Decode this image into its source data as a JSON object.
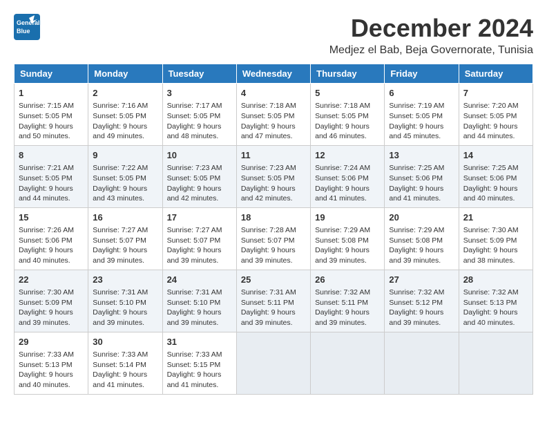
{
  "header": {
    "logo_line1": "General",
    "logo_line2": "Blue",
    "month": "December 2024",
    "location": "Medjez el Bab, Beja Governorate, Tunisia"
  },
  "weekdays": [
    "Sunday",
    "Monday",
    "Tuesday",
    "Wednesday",
    "Thursday",
    "Friday",
    "Saturday"
  ],
  "weeks": [
    [
      {
        "day": 1,
        "sunrise": "7:15 AM",
        "sunset": "5:05 PM",
        "daylight": "9 hours and 50 minutes."
      },
      {
        "day": 2,
        "sunrise": "7:16 AM",
        "sunset": "5:05 PM",
        "daylight": "9 hours and 49 minutes."
      },
      {
        "day": 3,
        "sunrise": "7:17 AM",
        "sunset": "5:05 PM",
        "daylight": "9 hours and 48 minutes."
      },
      {
        "day": 4,
        "sunrise": "7:18 AM",
        "sunset": "5:05 PM",
        "daylight": "9 hours and 47 minutes."
      },
      {
        "day": 5,
        "sunrise": "7:18 AM",
        "sunset": "5:05 PM",
        "daylight": "9 hours and 46 minutes."
      },
      {
        "day": 6,
        "sunrise": "7:19 AM",
        "sunset": "5:05 PM",
        "daylight": "9 hours and 45 minutes."
      },
      {
        "day": 7,
        "sunrise": "7:20 AM",
        "sunset": "5:05 PM",
        "daylight": "9 hours and 44 minutes."
      }
    ],
    [
      {
        "day": 8,
        "sunrise": "7:21 AM",
        "sunset": "5:05 PM",
        "daylight": "9 hours and 44 minutes."
      },
      {
        "day": 9,
        "sunrise": "7:22 AM",
        "sunset": "5:05 PM",
        "daylight": "9 hours and 43 minutes."
      },
      {
        "day": 10,
        "sunrise": "7:23 AM",
        "sunset": "5:05 PM",
        "daylight": "9 hours and 42 minutes."
      },
      {
        "day": 11,
        "sunrise": "7:23 AM",
        "sunset": "5:05 PM",
        "daylight": "9 hours and 42 minutes."
      },
      {
        "day": 12,
        "sunrise": "7:24 AM",
        "sunset": "5:06 PM",
        "daylight": "9 hours and 41 minutes."
      },
      {
        "day": 13,
        "sunrise": "7:25 AM",
        "sunset": "5:06 PM",
        "daylight": "9 hours and 41 minutes."
      },
      {
        "day": 14,
        "sunrise": "7:25 AM",
        "sunset": "5:06 PM",
        "daylight": "9 hours and 40 minutes."
      }
    ],
    [
      {
        "day": 15,
        "sunrise": "7:26 AM",
        "sunset": "5:06 PM",
        "daylight": "9 hours and 40 minutes."
      },
      {
        "day": 16,
        "sunrise": "7:27 AM",
        "sunset": "5:07 PM",
        "daylight": "9 hours and 39 minutes."
      },
      {
        "day": 17,
        "sunrise": "7:27 AM",
        "sunset": "5:07 PM",
        "daylight": "9 hours and 39 minutes."
      },
      {
        "day": 18,
        "sunrise": "7:28 AM",
        "sunset": "5:07 PM",
        "daylight": "9 hours and 39 minutes."
      },
      {
        "day": 19,
        "sunrise": "7:29 AM",
        "sunset": "5:08 PM",
        "daylight": "9 hours and 39 minutes."
      },
      {
        "day": 20,
        "sunrise": "7:29 AM",
        "sunset": "5:08 PM",
        "daylight": "9 hours and 39 minutes."
      },
      {
        "day": 21,
        "sunrise": "7:30 AM",
        "sunset": "5:09 PM",
        "daylight": "9 hours and 38 minutes."
      }
    ],
    [
      {
        "day": 22,
        "sunrise": "7:30 AM",
        "sunset": "5:09 PM",
        "daylight": "9 hours and 39 minutes."
      },
      {
        "day": 23,
        "sunrise": "7:31 AM",
        "sunset": "5:10 PM",
        "daylight": "9 hours and 39 minutes."
      },
      {
        "day": 24,
        "sunrise": "7:31 AM",
        "sunset": "5:10 PM",
        "daylight": "9 hours and 39 minutes."
      },
      {
        "day": 25,
        "sunrise": "7:31 AM",
        "sunset": "5:11 PM",
        "daylight": "9 hours and 39 minutes."
      },
      {
        "day": 26,
        "sunrise": "7:32 AM",
        "sunset": "5:11 PM",
        "daylight": "9 hours and 39 minutes."
      },
      {
        "day": 27,
        "sunrise": "7:32 AM",
        "sunset": "5:12 PM",
        "daylight": "9 hours and 39 minutes."
      },
      {
        "day": 28,
        "sunrise": "7:32 AM",
        "sunset": "5:13 PM",
        "daylight": "9 hours and 40 minutes."
      }
    ],
    [
      {
        "day": 29,
        "sunrise": "7:33 AM",
        "sunset": "5:13 PM",
        "daylight": "9 hours and 40 minutes."
      },
      {
        "day": 30,
        "sunrise": "7:33 AM",
        "sunset": "5:14 PM",
        "daylight": "9 hours and 41 minutes."
      },
      {
        "day": 31,
        "sunrise": "7:33 AM",
        "sunset": "5:15 PM",
        "daylight": "9 hours and 41 minutes."
      },
      null,
      null,
      null,
      null
    ]
  ]
}
